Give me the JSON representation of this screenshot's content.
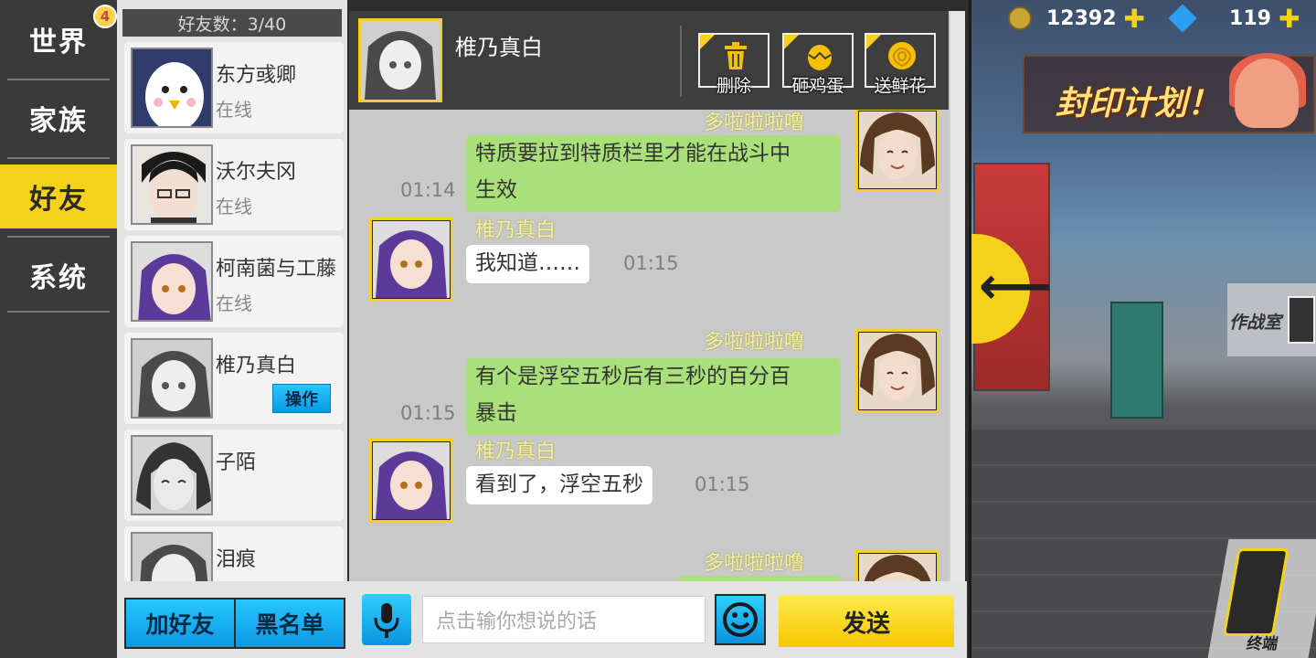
{
  "nav": {
    "items": [
      {
        "label": "世界",
        "active": false
      },
      {
        "label": "家族",
        "active": false
      },
      {
        "label": "好友",
        "active": true
      },
      {
        "label": "系统",
        "active": false
      }
    ],
    "badge": "4"
  },
  "friends": {
    "count_label": "好友数：3/40",
    "items": [
      {
        "name": "东方彧卿",
        "status": "在线"
      },
      {
        "name": "沃尔夫冈",
        "status": "在线"
      },
      {
        "name": "柯南菌与工藤",
        "status": "在线"
      },
      {
        "name": "椎乃真白",
        "status": "",
        "action": "操作"
      },
      {
        "name": "子陌",
        "status": ""
      },
      {
        "name": "泪痕",
        "status": ""
      }
    ]
  },
  "chat": {
    "contact_name": "椎乃真白",
    "actions": [
      {
        "label": "删除",
        "icon": "trash-icon"
      },
      {
        "label": "砸鸡蛋",
        "icon": "egg-icon"
      },
      {
        "label": "送鲜花",
        "icon": "flower-icon"
      }
    ],
    "messages": [
      {
        "sender": "多啦啦啦噜",
        "side": "right",
        "lines": [
          "特质要拉到特质栏里才能在战斗中",
          "生效"
        ],
        "time": "01:14"
      },
      {
        "sender": "椎乃真白",
        "side": "left",
        "lines": [
          "我知道……"
        ],
        "time": "01:15"
      },
      {
        "sender": "多啦啦啦噜",
        "side": "right",
        "lines": [
          "有个是浮空五秒后有三秒的百分百",
          "暴击"
        ],
        "time": "01:15"
      },
      {
        "sender": "椎乃真白",
        "side": "left",
        "lines": [
          "看到了，浮空五秒"
        ],
        "time": "01:15"
      },
      {
        "sender": "多啦啦啦噜",
        "side": "right",
        "lines": [
          ""
        ],
        "time": ""
      }
    ]
  },
  "bottom": {
    "add_friend": "加好友",
    "blacklist": "黑名单",
    "input_placeholder": "点击输你想说的话",
    "send": "发送"
  },
  "scene": {
    "gold": "12392",
    "gems": "119",
    "banner": "封印计划！",
    "war_room": "作战室",
    "terminal": "终端"
  },
  "colors": {
    "accent_yellow": "#f5d21a",
    "button_blue": "#0b98e3",
    "bubble_green": "#a9e07a"
  }
}
